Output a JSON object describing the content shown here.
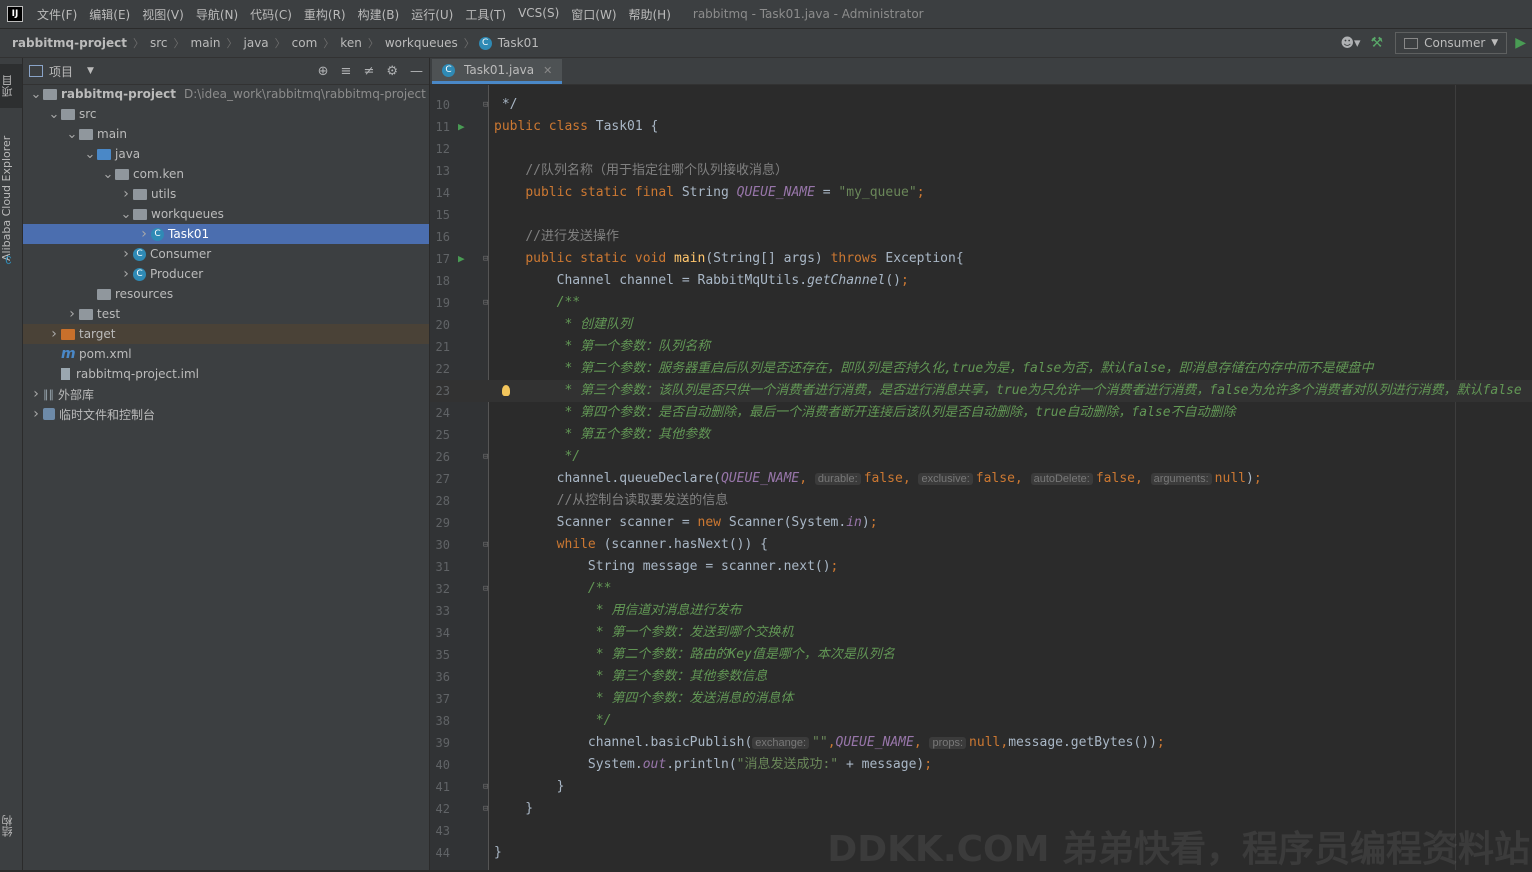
{
  "menubar": {
    "items": [
      "文件(F)",
      "编辑(E)",
      "视图(V)",
      "导航(N)",
      "代码(C)",
      "重构(R)",
      "构建(B)",
      "运行(U)",
      "工具(T)",
      "VCS(S)",
      "窗口(W)",
      "帮助(H)"
    ],
    "window_title": "rabbitmq - Task01.java - Administrator"
  },
  "breadcrumb": [
    "rabbitmq-project",
    "src",
    "main",
    "java",
    "com",
    "ken",
    "workqueues",
    "Task01"
  ],
  "run_config": "Consumer",
  "side_stripe": {
    "project": "项目",
    "cloud": "Alibaba Cloud Explorer",
    "structure": "结构"
  },
  "project_panel": {
    "title": "项目",
    "tree": [
      {
        "label": "rabbitmq-project",
        "path": "D:\\idea_work\\rabbitmq\\rabbitmq-project",
        "depth": 0,
        "icon": "module-folder-icon",
        "open": true,
        "bold": true
      },
      {
        "label": "src",
        "depth": 1,
        "icon": "folder-icon",
        "open": true
      },
      {
        "label": "main",
        "depth": 2,
        "icon": "folder-icon",
        "open": true
      },
      {
        "label": "java",
        "depth": 3,
        "icon": "source-folder-icon",
        "open": true
      },
      {
        "label": "com.ken",
        "depth": 4,
        "icon": "package-icon",
        "open": true
      },
      {
        "label": "utils",
        "depth": 5,
        "icon": "package-icon",
        "open": false
      },
      {
        "label": "workqueues",
        "depth": 5,
        "icon": "package-icon",
        "open": true
      },
      {
        "label": "Task01",
        "depth": 6,
        "icon": "class-icon",
        "open": false,
        "selected": true
      },
      {
        "label": "Consumer",
        "depth": 5,
        "icon": "class-icon",
        "open": false
      },
      {
        "label": "Producer",
        "depth": 5,
        "icon": "class-icon",
        "open": false
      },
      {
        "label": "resources",
        "depth": 3,
        "icon": "resources-folder-icon",
        "leaf": true
      },
      {
        "label": "test",
        "depth": 2,
        "icon": "folder-icon",
        "open": false
      },
      {
        "label": "target",
        "depth": 1,
        "icon": "excluded-folder-icon",
        "open": false,
        "excluded": true
      },
      {
        "label": "pom.xml",
        "depth": 1,
        "icon": "maven-icon",
        "leaf": true
      },
      {
        "label": "rabbitmq-project.iml",
        "depth": 1,
        "icon": "iml-file-icon",
        "leaf": true
      },
      {
        "label": "外部库",
        "depth": 0,
        "icon": "library-icon",
        "open": false
      },
      {
        "label": "临时文件和控制台",
        "depth": 0,
        "icon": "scratch-icon",
        "open": false
      }
    ]
  },
  "editor": {
    "tab": "Task01.java",
    "current_line": 23,
    "lines": [
      {
        "n": 10,
        "fold": true,
        "html": " */"
      },
      {
        "n": 11,
        "run": true,
        "html": "<span class=\"kw\">public class </span>Task01 {"
      },
      {
        "n": 12,
        "html": ""
      },
      {
        "n": 13,
        "html": "    <span class=\"cmt\">//队列名称（用于指定往哪个队列接收消息）</span>"
      },
      {
        "n": 14,
        "html": "    <span class=\"kw\">public static final </span>String <span class=\"const\">QUEUE_NAME</span> = <span class=\"str\">\"my_queue\"</span><span class=\"kw\">;</span>"
      },
      {
        "n": 15,
        "html": ""
      },
      {
        "n": 16,
        "html": "    <span class=\"cmt\">//进行发送操作</span>"
      },
      {
        "n": 17,
        "run": true,
        "fold": true,
        "html": "    <span class=\"kw\">public static void </span><span class=\"fn\">main</span>(String[] args) <span class=\"kw\">throws </span>Exception{"
      },
      {
        "n": 18,
        "html": "        Channel channel = RabbitMqUtils.<span class=\"static\">getChannel</span>()<span class=\"kw\">;</span>"
      },
      {
        "n": 19,
        "fold": true,
        "html": "        <span class=\"doc\">/**</span>"
      },
      {
        "n": 20,
        "html": "<span class=\"doc\">         * 创建队列</span>"
      },
      {
        "n": 21,
        "html": "<span class=\"doc\">         * 第一个参数：队列名称</span>"
      },
      {
        "n": 22,
        "html": "<span class=\"doc\">         * 第二个参数：服务器重启后队列是否还存在，即队列是否持久化,true为是，false为否，默认false，即消息存储在内存中而不是硬盘中</span>"
      },
      {
        "n": 23,
        "bulb": true,
        "html": "<span class=\"doc\">         * 第三个参数：该队列是否只供一个消费者进行消费，是否进行消息共享，true为只允许一个消费者进行消费，false为允许多个消费者对队列进行消费，默认false</span>"
      },
      {
        "n": 24,
        "html": "<span class=\"doc\">         * 第四个参数：是否自动删除，最后一个消费者断开连接后该队列是否自动删除，true自动删除，false不自动删除</span>"
      },
      {
        "n": 25,
        "html": "<span class=\"doc\">         * 第五个参数：其他参数</span>"
      },
      {
        "n": 26,
        "fold": true,
        "html": "<span class=\"doc\">         */</span>"
      },
      {
        "n": 27,
        "html": "        channel.queueDeclare(<span class=\"const\">QUEUE_NAME</span><span class=\"kw\">, </span><span class=\"hint\">durable:</span><span class=\"kw\">false, </span><span class=\"hint\">exclusive:</span><span class=\"kw\">false, </span><span class=\"hint\">autoDelete:</span><span class=\"kw\">false, </span><span class=\"hint\">arguments:</span><span class=\"kw\">null</span>)<span class=\"kw\">;</span>"
      },
      {
        "n": 28,
        "html": "        <span class=\"cmt\">//从控制台读取要发送的信息</span>"
      },
      {
        "n": 29,
        "html": "        Scanner scanner = <span class=\"kw\">new </span>Scanner(System.<span class=\"const\">in</span>)<span class=\"kw\">;</span>"
      },
      {
        "n": 30,
        "fold": true,
        "html": "        <span class=\"kw\">while </span>(scanner.hasNext()) {"
      },
      {
        "n": 31,
        "html": "            String message = scanner.next()<span class=\"kw\">;</span>"
      },
      {
        "n": 32,
        "fold": true,
        "html": "            <span class=\"doc\">/**</span>"
      },
      {
        "n": 33,
        "html": "<span class=\"doc\">             * 用信道对消息进行发布</span>"
      },
      {
        "n": 34,
        "html": "<span class=\"doc\">             * 第一个参数：发送到哪个交换机</span>"
      },
      {
        "n": 35,
        "html": "<span class=\"doc\">             * 第二个参数：路由的Key值是哪个，本次是队列名</span>"
      },
      {
        "n": 36,
        "html": "<span class=\"doc\">             * 第三个参数：其他参数信息</span>"
      },
      {
        "n": 37,
        "html": "<span class=\"doc\">             * 第四个参数：发送消息的消息体</span>"
      },
      {
        "n": 38,
        "html": "<span class=\"doc\">             */</span>"
      },
      {
        "n": 39,
        "html": "            channel.basicPublish(<span class=\"hint\">exchange:</span><span class=\"str\">\"\"</span><span class=\"kw\">,</span><span class=\"const\">QUEUE_NAME</span><span class=\"kw\">, </span><span class=\"hint\">props:</span><span class=\"kw\">null,</span>message.getBytes())<span class=\"kw\">;</span>"
      },
      {
        "n": 40,
        "html": "            System.<span class=\"const\">out</span>.println(<span class=\"str\">\"消息发送成功:\"</span> + message)<span class=\"kw\">;</span>"
      },
      {
        "n": 41,
        "fold": true,
        "html": "        }"
      },
      {
        "n": 42,
        "fold": true,
        "html": "    }"
      },
      {
        "n": 43,
        "html": ""
      },
      {
        "n": 44,
        "html": "}"
      }
    ]
  },
  "watermark": "DDKK.COM 弟弟快看，程序员编程资料站"
}
